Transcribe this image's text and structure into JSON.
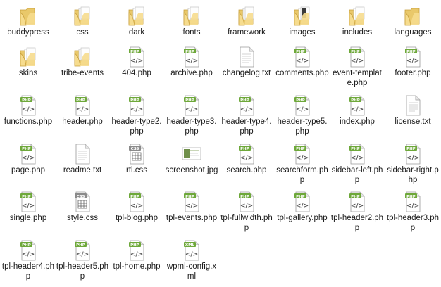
{
  "files": [
    {
      "name": "buddypress",
      "type": "folder",
      "icon": "folder-icon"
    },
    {
      "name": "css",
      "type": "folder-files",
      "icon": "folder-icon"
    },
    {
      "name": "dark",
      "type": "folder-files",
      "icon": "folder-icon"
    },
    {
      "name": "fonts",
      "type": "folder-files",
      "icon": "folder-icon"
    },
    {
      "name": "framework",
      "type": "folder-files",
      "icon": "folder-icon"
    },
    {
      "name": "images",
      "type": "folder-dark",
      "icon": "folder-icon"
    },
    {
      "name": "includes",
      "type": "folder-files",
      "icon": "folder-icon"
    },
    {
      "name": "languages",
      "type": "folder",
      "icon": "folder-icon"
    },
    {
      "name": "skins",
      "type": "folder-files",
      "icon": "folder-icon"
    },
    {
      "name": "tribe-events",
      "type": "folder-files",
      "icon": "folder-icon"
    },
    {
      "name": "404.php",
      "type": "php",
      "icon": "php-file-icon"
    },
    {
      "name": "archive.php",
      "type": "php",
      "icon": "php-file-icon"
    },
    {
      "name": "changelog.txt",
      "type": "txt",
      "icon": "text-file-icon"
    },
    {
      "name": "comments.php",
      "type": "php",
      "icon": "php-file-icon"
    },
    {
      "name": "event-template.php",
      "type": "php",
      "icon": "php-file-icon"
    },
    {
      "name": "footer.php",
      "type": "php",
      "icon": "php-file-icon"
    },
    {
      "name": "functions.php",
      "type": "php",
      "icon": "php-file-icon"
    },
    {
      "name": "header.php",
      "type": "php",
      "icon": "php-file-icon"
    },
    {
      "name": "header-type2.php",
      "type": "php",
      "icon": "php-file-icon"
    },
    {
      "name": "header-type3.php",
      "type": "php",
      "icon": "php-file-icon"
    },
    {
      "name": "header-type4.php",
      "type": "php",
      "icon": "php-file-icon"
    },
    {
      "name": "header-type5.php",
      "type": "php",
      "icon": "php-file-icon"
    },
    {
      "name": "index.php",
      "type": "php",
      "icon": "php-file-icon"
    },
    {
      "name": "license.txt",
      "type": "txt",
      "icon": "text-file-icon"
    },
    {
      "name": "page.php",
      "type": "php",
      "icon": "php-file-icon"
    },
    {
      "name": "readme.txt",
      "type": "txt",
      "icon": "text-file-icon"
    },
    {
      "name": "rtl.css",
      "type": "css",
      "icon": "css-file-icon"
    },
    {
      "name": "screenshot.jpg",
      "type": "jpg",
      "icon": "image-file-icon"
    },
    {
      "name": "search.php",
      "type": "php",
      "icon": "php-file-icon"
    },
    {
      "name": "searchform.php",
      "type": "php",
      "icon": "php-file-icon"
    },
    {
      "name": "sidebar-left.php",
      "type": "php",
      "icon": "php-file-icon"
    },
    {
      "name": "sidebar-right.php",
      "type": "php",
      "icon": "php-file-icon"
    },
    {
      "name": "single.php",
      "type": "php",
      "icon": "php-file-icon"
    },
    {
      "name": "style.css",
      "type": "css",
      "icon": "css-file-icon"
    },
    {
      "name": "tpl-blog.php",
      "type": "php",
      "icon": "php-file-icon"
    },
    {
      "name": "tpl-events.php",
      "type": "php",
      "icon": "php-file-icon"
    },
    {
      "name": "tpl-fullwidth.php",
      "type": "php",
      "icon": "php-file-icon"
    },
    {
      "name": "tpl-gallery.php",
      "type": "php",
      "icon": "php-file-icon"
    },
    {
      "name": "tpl-header2.php",
      "type": "php",
      "icon": "php-file-icon"
    },
    {
      "name": "tpl-header3.php",
      "type": "php",
      "icon": "php-file-icon"
    },
    {
      "name": "tpl-header4.php",
      "type": "php",
      "icon": "php-file-icon"
    },
    {
      "name": "tpl-header5.php",
      "type": "php",
      "icon": "php-file-icon"
    },
    {
      "name": "tpl-home.php",
      "type": "php",
      "icon": "php-file-icon"
    },
    {
      "name": "wpml-config.xml",
      "type": "xml",
      "icon": "xml-file-icon"
    }
  ],
  "badges": {
    "php": "PHP",
    "css": "CSS",
    "xml": "XML"
  },
  "colors": {
    "folder_back": "#e9c86a",
    "folder_front": "#f6dc8e",
    "folder_edge": "#c9a03c",
    "php_badge": "#6ea83a",
    "css_badge": "#8a8a8a",
    "xml_badge": "#6ea83a",
    "sheet": "#ffffff",
    "sheet_edge": "#9a9a9a"
  }
}
